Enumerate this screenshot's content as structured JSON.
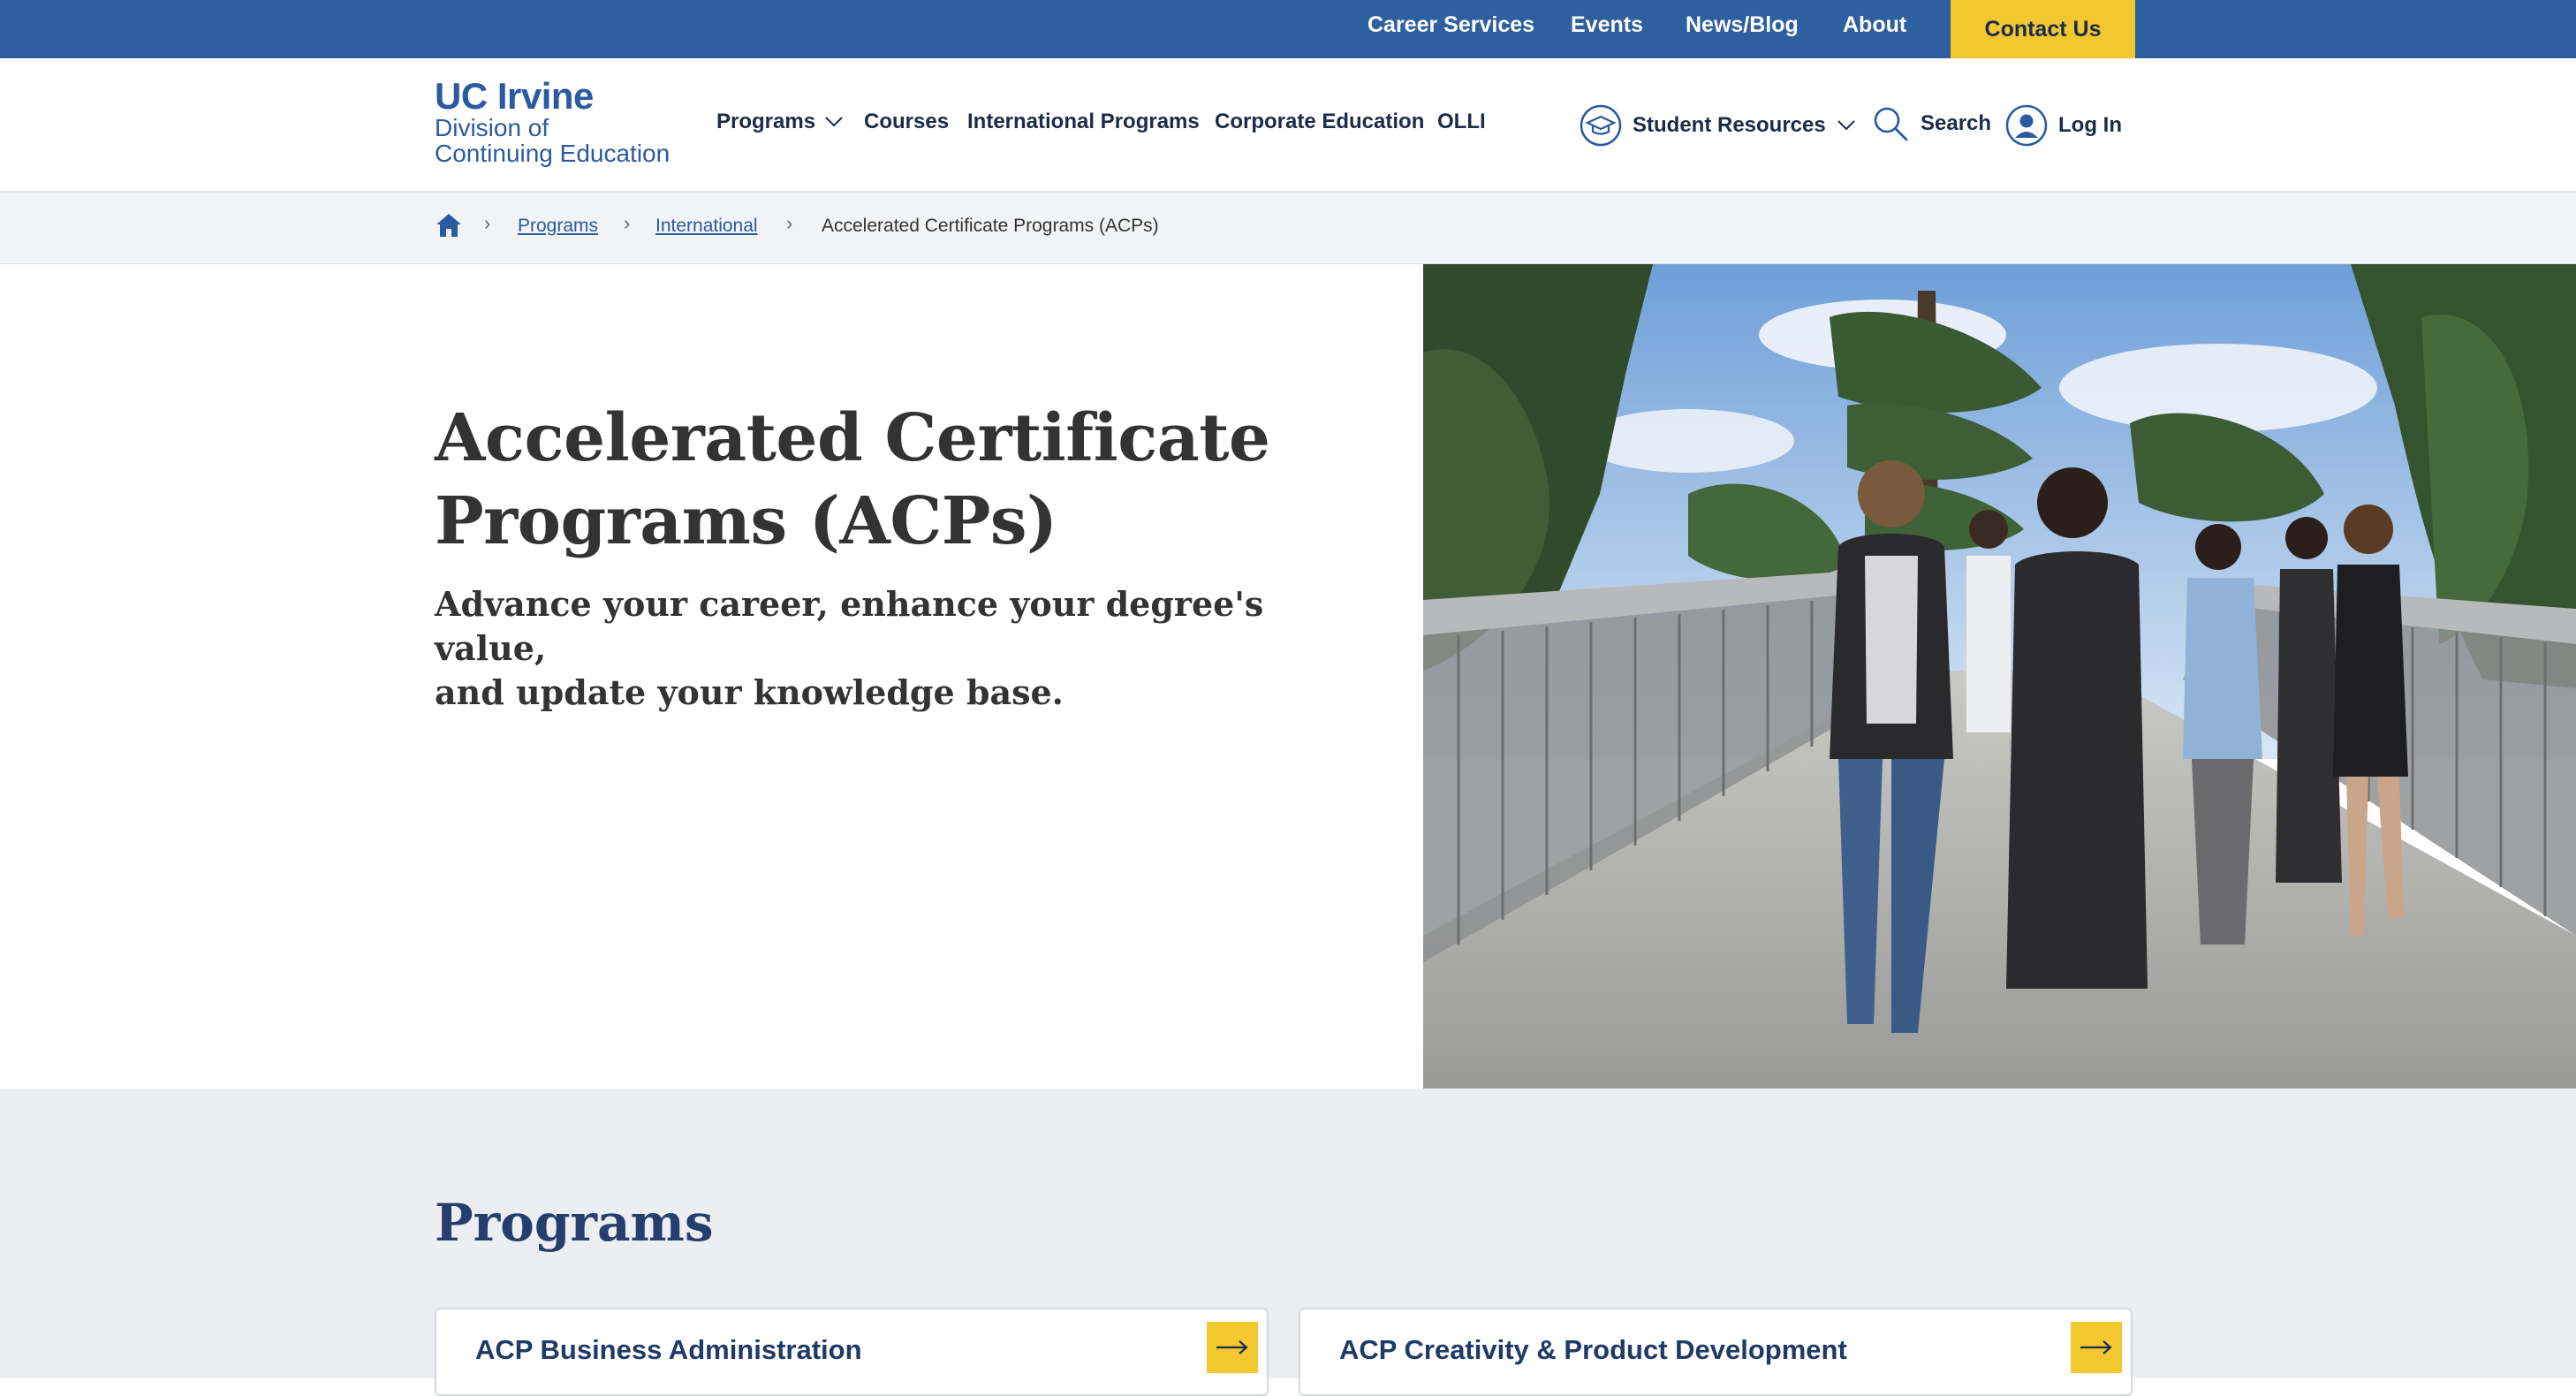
{
  "utility_nav": {
    "items": [
      "Career Services",
      "Events",
      "News/Blog",
      "About"
    ],
    "contact": "Contact Us"
  },
  "logo": {
    "line1": "UC Irvine",
    "line2": "Division of",
    "line3": "Continuing Education"
  },
  "main_nav": {
    "programs": "Programs",
    "courses": "Courses",
    "international": "International Programs",
    "corporate": "Corporate Education",
    "olli": "OLLI"
  },
  "user_nav": {
    "student_resources": "Student Resources",
    "search": "Search",
    "login": "Log In"
  },
  "breadcrumb": {
    "items": [
      "Programs",
      "International",
      "Accelerated Certificate Programs (ACPs)"
    ]
  },
  "hero": {
    "title_line1": "Accelerated Certificate",
    "title_line2": "Programs (ACPs)",
    "subtitle_line1": "Advance your career, enhance your degree's value,",
    "subtitle_line2": "and update your knowledge base."
  },
  "programs": {
    "heading": "Programs",
    "cards": [
      {
        "title": "ACP Business Administration"
      },
      {
        "title": "ACP Creativity & Product Development"
      }
    ]
  },
  "colors": {
    "utility_bar": "#2e5f9e",
    "accent_yellow": "#f3c72e",
    "navy": "#1c2b4a"
  }
}
